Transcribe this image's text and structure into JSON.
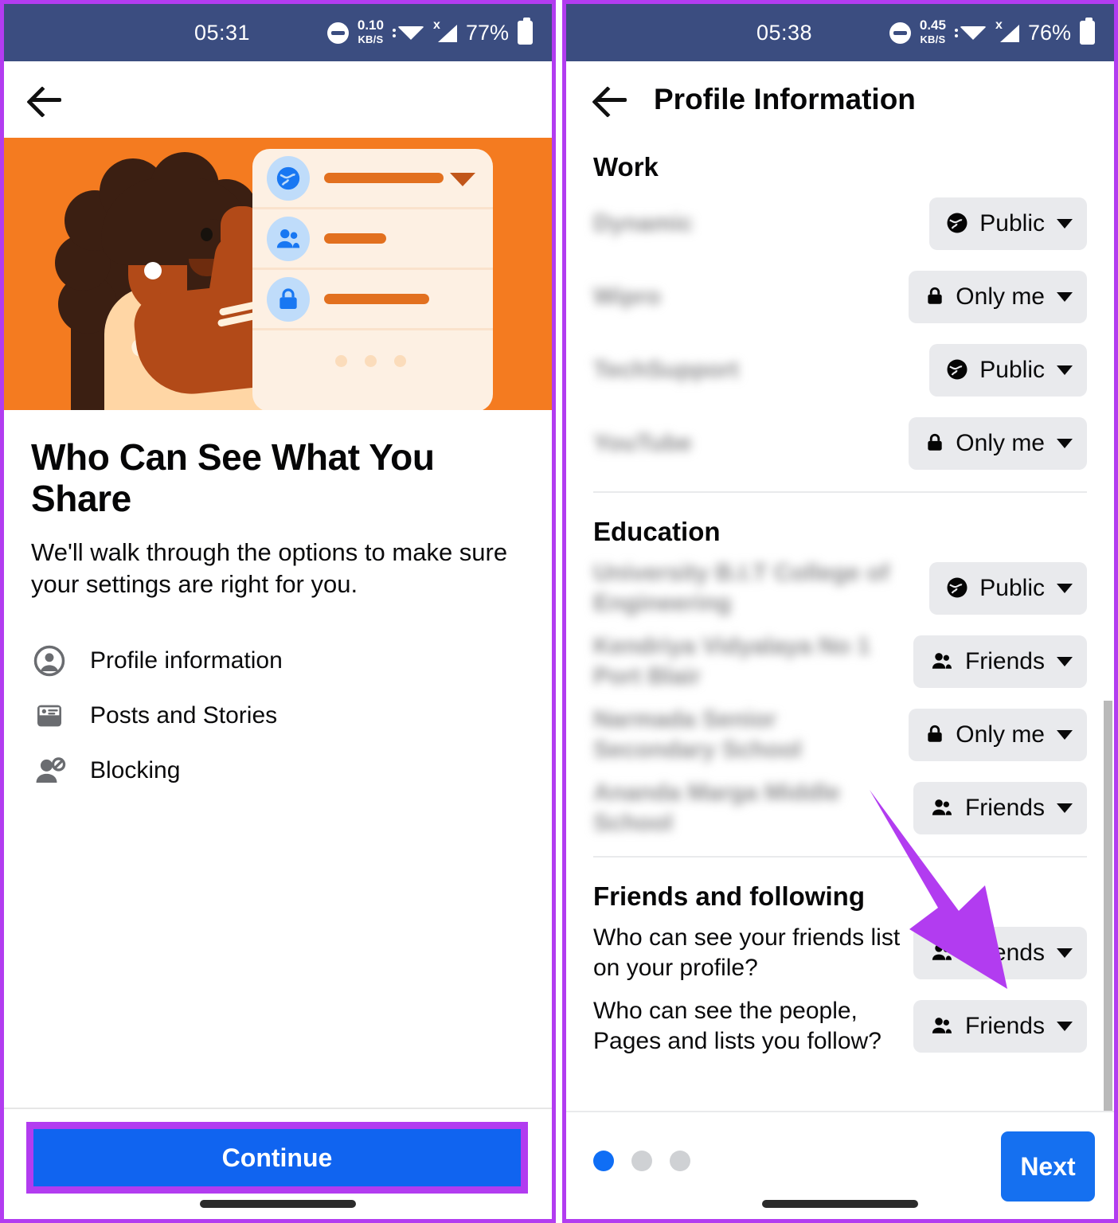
{
  "left": {
    "status": {
      "time": "05:31",
      "data_speed": "0.10",
      "data_unit": "KB/S",
      "battery_pct": "77%",
      "dnd_icon": "do-not-disturb-icon",
      "wifi_icon": "wifi-icon",
      "signal_icon": "signal-no-sim-icon",
      "battery_icon": "battery-icon"
    },
    "back_icon": "back-arrow-icon",
    "illustration": {
      "alt": "privacy-checkup-illustration",
      "row_icons": [
        "globe-icon",
        "people-icon",
        "lock-icon"
      ]
    },
    "title": "Who Can See What You Share",
    "subtitle": "We'll walk through the options to make sure your settings are right for you.",
    "features": [
      {
        "icon": "profile-avatar-icon",
        "label": "Profile information"
      },
      {
        "icon": "posts-stories-icon",
        "label": "Posts and Stories"
      },
      {
        "icon": "blocking-icon",
        "label": "Blocking"
      }
    ],
    "continue_label": "Continue"
  },
  "right": {
    "status": {
      "time": "05:38",
      "data_speed": "0.45",
      "data_unit": "KB/S",
      "battery_pct": "76%",
      "dnd_icon": "do-not-disturb-icon",
      "wifi_icon": "wifi-icon",
      "signal_icon": "signal-no-sim-icon",
      "battery_icon": "battery-icon"
    },
    "back_icon": "back-arrow-icon",
    "page_title": "Profile Information",
    "sections": [
      {
        "title": "Work",
        "rows": [
          {
            "label": "",
            "blurred": true,
            "audience": "Public",
            "icon": "globe-icon"
          },
          {
            "label": "",
            "blurred": true,
            "audience": "Only me",
            "icon": "lock-icon"
          },
          {
            "label": "",
            "blurred": true,
            "audience": "Public",
            "icon": "globe-icon"
          },
          {
            "label": "",
            "blurred": true,
            "audience": "Only me",
            "icon": "lock-icon"
          }
        ]
      },
      {
        "title": "Education",
        "rows": [
          {
            "label": "",
            "blurred": true,
            "audience": "Public",
            "icon": "globe-icon"
          },
          {
            "label": "",
            "blurred": true,
            "audience": "Friends",
            "icon": "friends-icon"
          },
          {
            "label": "",
            "blurred": true,
            "audience": "Only me",
            "icon": "lock-icon"
          },
          {
            "label": "",
            "blurred": true,
            "audience": "Friends",
            "icon": "friends-icon"
          }
        ]
      },
      {
        "title": "Friends and following",
        "rows": [
          {
            "label": "Who can see your friends list on your profile?",
            "blurred": false,
            "audience": "Friends",
            "icon": "friends-icon"
          },
          {
            "label": "Who can see the people, Pages and lists you follow?",
            "blurred": false,
            "audience": "Friends",
            "icon": "friends-icon"
          }
        ]
      }
    ],
    "pager": {
      "total": 3,
      "active": 1
    },
    "next_label": "Next"
  },
  "annotations": {
    "highlight_color": "#b23cf0",
    "arrow": {
      "name": "pointer-arrow",
      "color": "#b23cf0",
      "points_to": "friends-list-audience-pill"
    }
  }
}
